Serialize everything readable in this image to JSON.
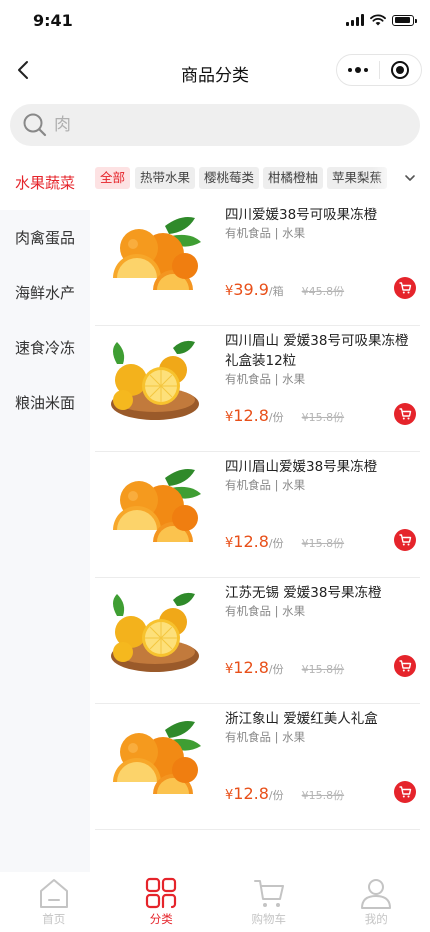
{
  "status_bar": {
    "time": "9:41"
  },
  "nav": {
    "title": "商品分类"
  },
  "search": {
    "placeholder": "肉"
  },
  "sidebar": {
    "items": [
      {
        "label": "水果蔬菜",
        "active": true
      },
      {
        "label": "肉禽蛋品"
      },
      {
        "label": "海鲜水产"
      },
      {
        "label": "速食冷冻"
      },
      {
        "label": "粮油米面"
      }
    ]
  },
  "tags": [
    {
      "label": "全部",
      "active": true
    },
    {
      "label": "热带水果"
    },
    {
      "label": "樱桃莓类"
    },
    {
      "label": "柑橘橙柚"
    },
    {
      "label": "苹果梨蕉"
    }
  ],
  "products": [
    {
      "name": "四川爱媛38号可吸果冻橙",
      "meta": "有机食品 | 水果",
      "currency": "¥",
      "price": "39.9",
      "unit": "/箱",
      "old_price": "¥45.8份",
      "image_icon": "orange-image"
    },
    {
      "name": "四川眉山 爱媛38号可吸果冻橙礼盒装12粒",
      "meta": "有机食品 | 水果",
      "currency": "¥",
      "price": "12.8",
      "unit": "/份",
      "old_price": "¥15.8份",
      "image_icon": "orange-bowl-image"
    },
    {
      "name": "四川眉山爱媛38号果冻橙",
      "meta": "有机食品 | 水果",
      "currency": "¥",
      "price": "12.8",
      "unit": "/份",
      "old_price": "¥15.8份",
      "image_icon": "orange-image"
    },
    {
      "name": "江苏无锡 爱媛38号果冻橙",
      "meta": "有机食品 | 水果",
      "currency": "¥",
      "price": "12.8",
      "unit": "/份",
      "old_price": "¥15.8份",
      "image_icon": "orange-bowl-image"
    },
    {
      "name": "浙江象山 爱媛红美人礼盒",
      "meta": "有机食品 | 水果",
      "currency": "¥",
      "price": "12.8",
      "unit": "/份",
      "old_price": "¥15.8份",
      "image_icon": "orange-image"
    }
  ],
  "tabbar": [
    {
      "label": "首页",
      "icon": "home-icon"
    },
    {
      "label": "分类",
      "icon": "category-icon",
      "active": true
    },
    {
      "label": "购物车",
      "icon": "cart-icon"
    },
    {
      "label": "我的",
      "icon": "user-icon"
    }
  ],
  "colors": {
    "accent": "#e5242b",
    "price": "#e8501a",
    "sidebar_bg": "#f7f8fa"
  }
}
